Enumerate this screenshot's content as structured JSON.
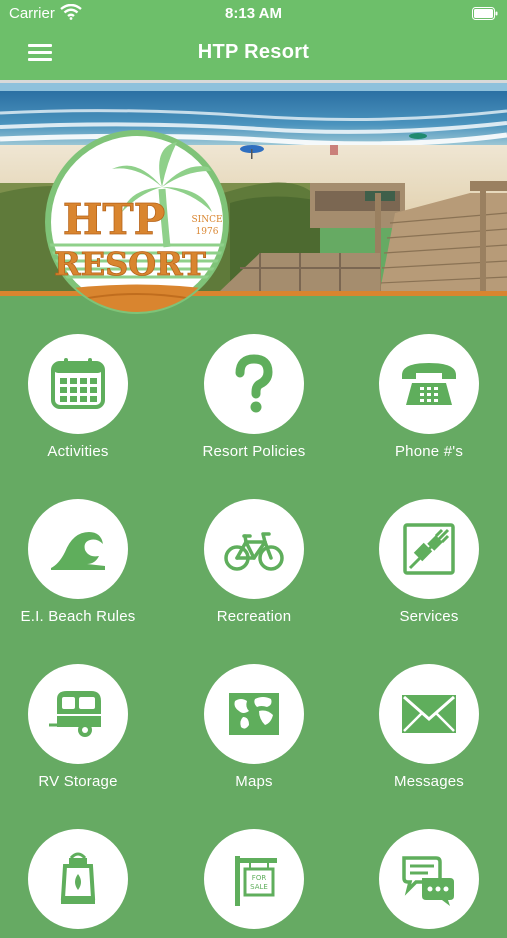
{
  "status_bar": {
    "carrier": "Carrier",
    "time": "8:13 AM"
  },
  "navbar": {
    "title": "HTP Resort",
    "menu_icon": "hamburger-menu-icon"
  },
  "logo": {
    "line1": "HTP",
    "line2": "RESORT",
    "since": "SINCE",
    "year": "1976"
  },
  "colors": {
    "brand_green": "#6dbf6a",
    "background": "#66aa63",
    "icon_green": "#5fae5c",
    "accent_orange": "#d9852f"
  },
  "tiles": [
    {
      "label": "Activities",
      "icon": "calendar-icon"
    },
    {
      "label": "Resort Policies",
      "icon": "question-mark-icon"
    },
    {
      "label": "Phone #'s",
      "icon": "telephone-icon"
    },
    {
      "label": "E.I. Beach Rules",
      "icon": "wave-icon"
    },
    {
      "label": "Recreation",
      "icon": "bicycle-icon"
    },
    {
      "label": "Services",
      "icon": "plug-icon"
    },
    {
      "label": "RV Storage",
      "icon": "camper-trailer-icon"
    },
    {
      "label": "Maps",
      "icon": "map-icon"
    },
    {
      "label": "Messages",
      "icon": "envelope-icon"
    },
    {
      "label": "",
      "icon": "lantern-icon"
    },
    {
      "label": "",
      "icon": "for-sale-sign-icon"
    },
    {
      "label": "",
      "icon": "chat-bubbles-icon"
    }
  ],
  "sign_text": {
    "line1": "FOR",
    "line2": "SALE"
  }
}
